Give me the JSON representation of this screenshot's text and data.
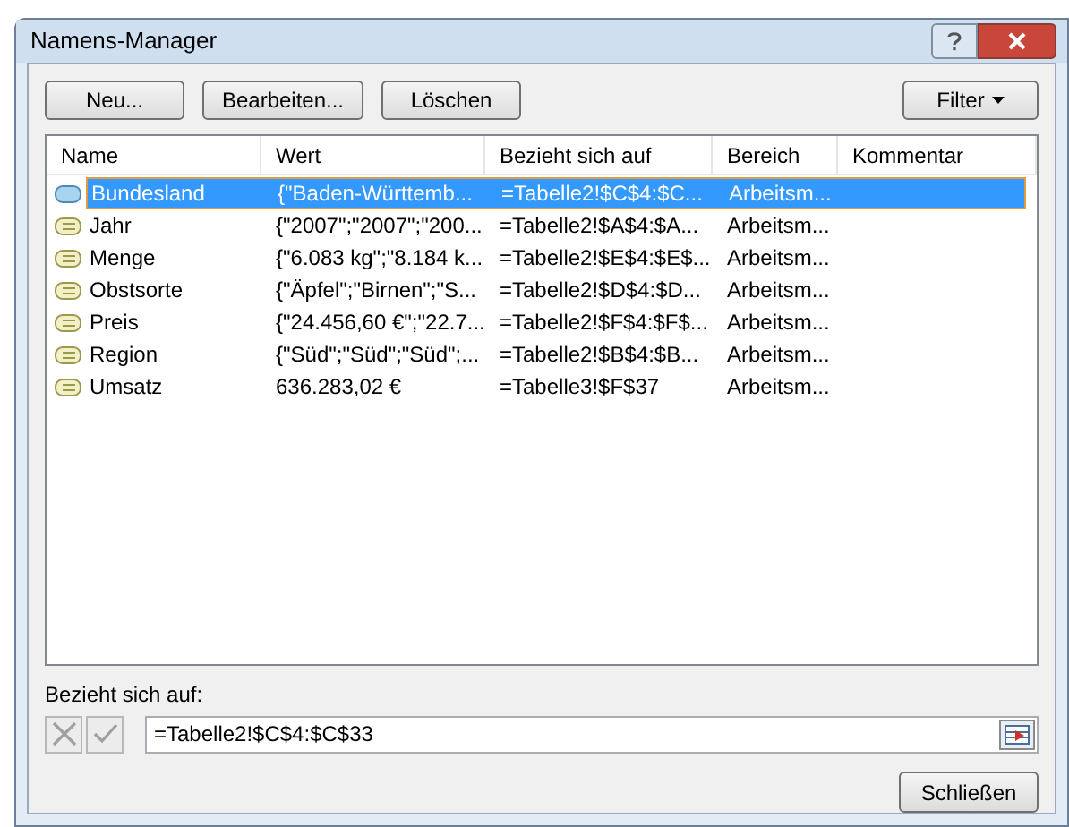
{
  "window": {
    "title": "Namens-Manager"
  },
  "toolbar": {
    "buttons": [
      "Neu...",
      "Bearbeiten...",
      "Löschen"
    ],
    "filter": "Filter"
  },
  "table": {
    "columns": [
      "Name",
      "Wert",
      "Bezieht sich auf",
      "Bereich",
      "Kommentar"
    ],
    "rows": [
      {
        "name": "Bundesland",
        "value": "{\"Baden-Württemb...",
        "refers_to": "=Tabelle2!$C$4:$C...",
        "scope": "Arbeitsm...",
        "selected": true
      },
      {
        "name": "Jahr",
        "value": "{\"2007\";\"2007\";\"200...",
        "refers_to": "=Tabelle2!$A$4:$A...",
        "scope": "Arbeitsm...",
        "selected": false
      },
      {
        "name": "Menge",
        "value": "{\"6.083 kg\";\"8.184 k...",
        "refers_to": "=Tabelle2!$E$4:$E$...",
        "scope": "Arbeitsm...",
        "selected": false
      },
      {
        "name": "Obstsorte",
        "value": "{\"Äpfel\";\"Birnen\";\"S...",
        "refers_to": "=Tabelle2!$D$4:$D...",
        "scope": "Arbeitsm...",
        "selected": false
      },
      {
        "name": "Preis",
        "value": "{\"24.456,60 €\";\"22.7...",
        "refers_to": "=Tabelle2!$F$4:$F$...",
        "scope": "Arbeitsm...",
        "selected": false
      },
      {
        "name": "Region",
        "value": "{\"Süd\";\"Süd\";\"Süd\";...",
        "refers_to": "=Tabelle2!$B$4:$B...",
        "scope": "Arbeitsm...",
        "selected": false
      },
      {
        "name": "Umsatz",
        "value": "636.283,02 €",
        "refers_to": "=Tabelle3!$F$37",
        "scope": "Arbeitsm...",
        "selected": false
      }
    ]
  },
  "refers_to": {
    "label": "Bezieht sich auf:",
    "value": "=Tabelle2!$C$4:$C$33",
    "cancel_disabled": true,
    "confirm_disabled": true
  },
  "close_button": "Schließen"
}
